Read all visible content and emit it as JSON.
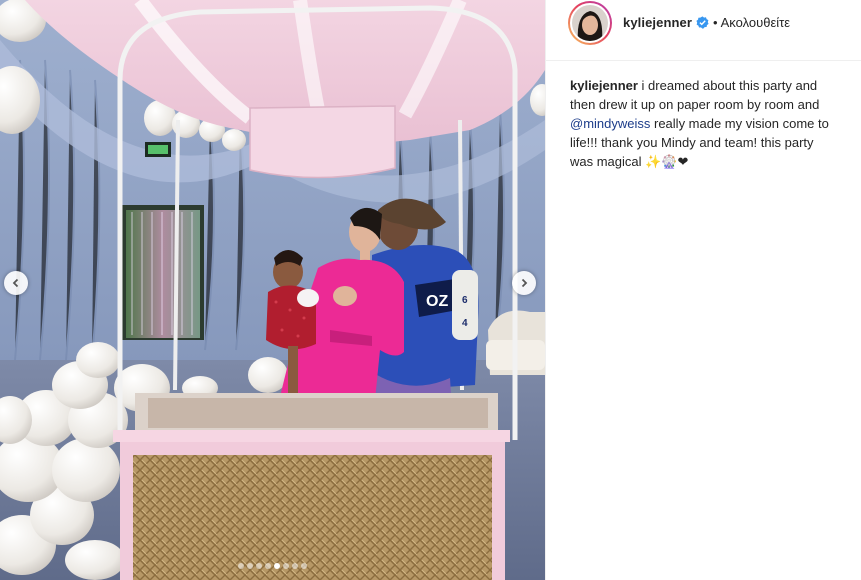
{
  "post": {
    "image_alt": "Party photo: family inside a pink hot-air-balloon basket",
    "carousel": {
      "total": 8,
      "active_index": 4
    },
    "prev_icon": "chevron-left-icon",
    "next_icon": "chevron-right-icon"
  },
  "header": {
    "username": "kyliejenner",
    "verified_icon": "verified-badge-icon",
    "separator": "•",
    "follow_status": "Ακολουθείτε"
  },
  "caption": {
    "username": "kyliejenner",
    "text_before": " i dreamed about this party and then drew it up on paper room by room and ",
    "mention": "@mindyweiss",
    "text_after": " really made my vision come to life!!! thank you Mindy and team! this party was magical ✨🎡❤"
  },
  "colors": {
    "verified_blue": "#3897f0",
    "mention": "#1d3d8a",
    "text": "#262626",
    "story_ring_start": "#f9c65d",
    "story_ring_end": "#b23eb6"
  }
}
